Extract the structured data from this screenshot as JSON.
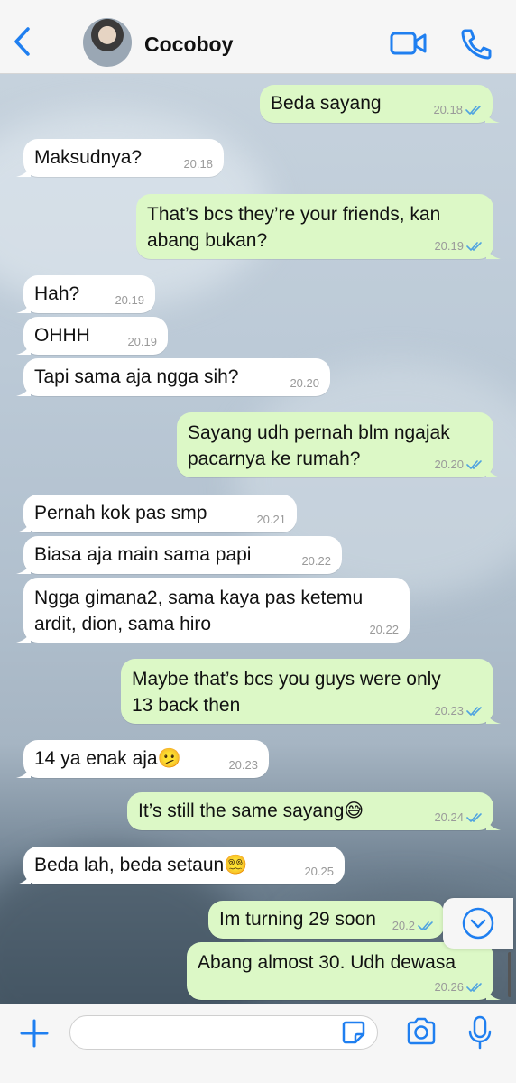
{
  "header": {
    "contact_name": "Cocoboy",
    "accent_color": "#1f7ff0",
    "icons": [
      "back-chevron-icon",
      "video-call-icon",
      "phone-icon"
    ]
  },
  "messages": [
    {
      "dir": "out",
      "lines": [
        "Beda sayang"
      ],
      "time": "20.18"
    },
    {
      "dir": "in",
      "lines": [
        "Maksudnya?"
      ],
      "time": "20.18"
    },
    {
      "dir": "out",
      "lines": [
        "That’s bcs they’re your friends, kan",
        "abang bukan?"
      ],
      "time": "20.19"
    },
    {
      "dir": "in",
      "lines": [
        "Hah?"
      ],
      "time": "20.19"
    },
    {
      "dir": "in",
      "lines": [
        "OHHH"
      ],
      "time": "20.19"
    },
    {
      "dir": "in",
      "lines": [
        "Tapi sama aja ngga sih?"
      ],
      "time": "20.20"
    },
    {
      "dir": "out",
      "lines": [
        "Sayang udh pernah blm ngajak",
        "pacarnya ke rumah?"
      ],
      "time": "20.20"
    },
    {
      "dir": "in",
      "lines": [
        "Pernah kok pas smp"
      ],
      "time": "20.21"
    },
    {
      "dir": "in",
      "lines": [
        "Biasa aja main sama papi"
      ],
      "time": "20.22"
    },
    {
      "dir": "in",
      "lines": [
        "Ngga gimana2, sama kaya pas ketemu",
        "ardit, dion, sama hiro"
      ],
      "time": "20.22"
    },
    {
      "dir": "out",
      "lines": [
        "Maybe that’s bcs you guys were only",
        "13 back then"
      ],
      "time": "20.23"
    },
    {
      "dir": "in",
      "lines": [
        "14 ya enak aja🫤"
      ],
      "time": "20.23"
    },
    {
      "dir": "out",
      "lines": [
        "It’s still the same sayang😅"
      ],
      "time": "20.24"
    },
    {
      "dir": "in",
      "lines": [
        "Beda lah, beda setaun😵‍💫"
      ],
      "time": "20.25"
    },
    {
      "dir": "out",
      "lines": [
        "Im turning 29 soon"
      ],
      "time": "20.2"
    },
    {
      "dir": "out",
      "lines": [
        "Abang almost 30. Udh dewasa"
      ],
      "time": "20.26"
    }
  ],
  "composer": {
    "placeholder": "",
    "icons": [
      "plus-icon",
      "sticker-icon",
      "camera-icon",
      "microphone-icon"
    ]
  },
  "colors": {
    "incoming_bubble": "#ffffff",
    "outgoing_bubble": "#dcf8c6",
    "read_ticks": "#4fa3e0"
  }
}
